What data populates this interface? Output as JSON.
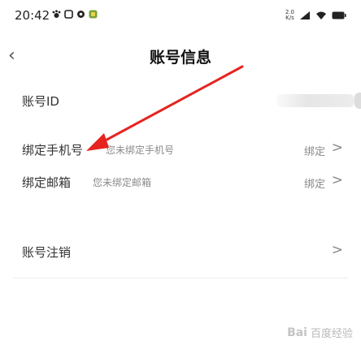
{
  "status": {
    "time": "20:42",
    "notification_icons": [
      "paw-icon",
      "square-icon",
      "circle-icon",
      "app-icon"
    ],
    "network_speed": [
      "2.0",
      "K/s"
    ],
    "system_icons": [
      "signal-icon",
      "wifi-icon",
      "battery-icon"
    ]
  },
  "header": {
    "back_icon": "‹",
    "title": "账号信息"
  },
  "rows": [
    {
      "label": "账号ID",
      "sub": "",
      "action": "",
      "chevron": ""
    },
    {
      "label": "绑定手机号",
      "sub": "您未绑定手机号",
      "action": "绑定",
      "chevron": ">"
    },
    {
      "label": "绑定邮箱",
      "sub": "您未绑定邮箱",
      "action": "绑定",
      "chevron": ">"
    },
    {
      "label": "账号注销",
      "sub": "",
      "action": "",
      "chevron": ">"
    }
  ],
  "annotation": {
    "color": "#e52420",
    "type": "arrow"
  },
  "watermark": {
    "logo": "Bai",
    "text": "百度经验"
  }
}
